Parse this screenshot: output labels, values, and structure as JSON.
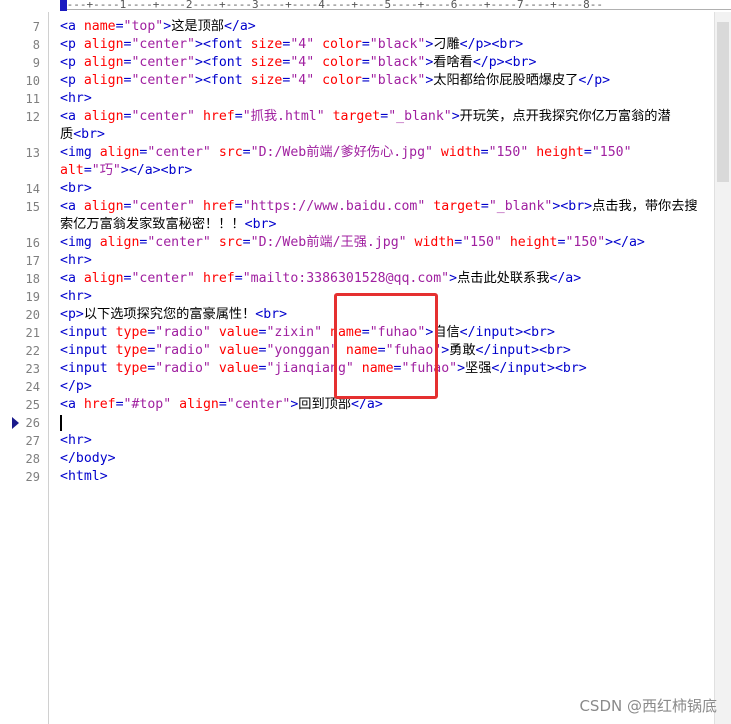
{
  "ruler": {
    "text": "----+----1----+----2----+----3----+----4----+----5----+----6----+----7----+----8--"
  },
  "current_line": "26",
  "lines": [
    {
      "n": "7",
      "spans": [
        [
          "t",
          "<a "
        ],
        [
          "a",
          "name"
        ],
        [
          "t",
          "="
        ],
        [
          "v",
          "\"top\""
        ],
        [
          "t",
          ">"
        ],
        [
          "x",
          "这是顶部"
        ],
        [
          "t",
          "</a>"
        ]
      ]
    },
    {
      "n": "8",
      "spans": [
        [
          "t",
          "<p "
        ],
        [
          "a",
          "align"
        ],
        [
          "t",
          "="
        ],
        [
          "v",
          "\"center\""
        ],
        [
          "t",
          ">"
        ],
        [
          "t",
          "<font "
        ],
        [
          "a",
          "size"
        ],
        [
          "t",
          "="
        ],
        [
          "v",
          "\"4\""
        ],
        [
          "t",
          " "
        ],
        [
          "a",
          "color"
        ],
        [
          "t",
          "="
        ],
        [
          "v",
          "\"black\""
        ],
        [
          "t",
          ">"
        ],
        [
          "x",
          "刁雕"
        ],
        [
          "t",
          "</p>"
        ],
        [
          "t",
          "<br>"
        ]
      ]
    },
    {
      "n": "9",
      "spans": [
        [
          "t",
          "<p "
        ],
        [
          "a",
          "align"
        ],
        [
          "t",
          "="
        ],
        [
          "v",
          "\"center\""
        ],
        [
          "t",
          ">"
        ],
        [
          "t",
          "<font "
        ],
        [
          "a",
          "size"
        ],
        [
          "t",
          "="
        ],
        [
          "v",
          "\"4\""
        ],
        [
          "t",
          " "
        ],
        [
          "a",
          "color"
        ],
        [
          "t",
          "="
        ],
        [
          "v",
          "\"black\""
        ],
        [
          "t",
          ">"
        ],
        [
          "x",
          "看啥看"
        ],
        [
          "t",
          "</p>"
        ],
        [
          "t",
          "<br>"
        ]
      ]
    },
    {
      "n": "10",
      "spans": [
        [
          "t",
          "<p "
        ],
        [
          "a",
          "align"
        ],
        [
          "t",
          "="
        ],
        [
          "v",
          "\"center\""
        ],
        [
          "t",
          ">"
        ],
        [
          "t",
          "<font "
        ],
        [
          "a",
          "size"
        ],
        [
          "t",
          "="
        ],
        [
          "v",
          "\"4\""
        ],
        [
          "t",
          " "
        ],
        [
          "a",
          "color"
        ],
        [
          "t",
          "="
        ],
        [
          "v",
          "\"black\""
        ],
        [
          "t",
          ">"
        ],
        [
          "x",
          "太阳都给你屁股晒爆皮了"
        ],
        [
          "t",
          "</p>"
        ]
      ]
    },
    {
      "n": "11",
      "spans": [
        [
          "t",
          "<hr>"
        ]
      ]
    },
    {
      "n": "12",
      "spans": [
        [
          "t",
          "<a "
        ],
        [
          "a",
          "align"
        ],
        [
          "t",
          "="
        ],
        [
          "v",
          "\"center\""
        ],
        [
          "t",
          " "
        ],
        [
          "a",
          "href"
        ],
        [
          "t",
          "="
        ],
        [
          "v",
          "\"抓我.html\""
        ],
        [
          "t",
          " "
        ],
        [
          "a",
          "target"
        ],
        [
          "t",
          "="
        ],
        [
          "v",
          "\"_blank\""
        ],
        [
          "t",
          ">"
        ],
        [
          "x",
          "开玩笑，点开我探究你亿万富翁的潜"
        ]
      ]
    },
    {
      "n": "",
      "spans": [
        [
          "x",
          "质"
        ],
        [
          "t",
          "<br>"
        ]
      ]
    },
    {
      "n": "13",
      "spans": [
        [
          "t",
          "<img "
        ],
        [
          "a",
          "align"
        ],
        [
          "t",
          "="
        ],
        [
          "v",
          "\"center\""
        ],
        [
          "t",
          " "
        ],
        [
          "a",
          "src"
        ],
        [
          "t",
          "="
        ],
        [
          "v",
          "\"D:/Web前端/爹好伤心.jpg\""
        ],
        [
          "t",
          " "
        ],
        [
          "a",
          "width"
        ],
        [
          "t",
          "="
        ],
        [
          "v",
          "\"150\""
        ],
        [
          "t",
          " "
        ],
        [
          "a",
          "height"
        ],
        [
          "t",
          "="
        ],
        [
          "v",
          "\"150\""
        ]
      ]
    },
    {
      "n": "",
      "spans": [
        [
          "a",
          "alt"
        ],
        [
          "t",
          "="
        ],
        [
          "v",
          "\"巧\""
        ],
        [
          "t",
          ">"
        ],
        [
          "t",
          "</a>"
        ],
        [
          "t",
          "<br>"
        ]
      ]
    },
    {
      "n": "14",
      "spans": [
        [
          "t",
          "<br>"
        ]
      ]
    },
    {
      "n": "15",
      "spans": [
        [
          "t",
          "<a "
        ],
        [
          "a",
          "align"
        ],
        [
          "t",
          "="
        ],
        [
          "v",
          "\"center\""
        ],
        [
          "t",
          " "
        ],
        [
          "a",
          "href"
        ],
        [
          "t",
          "="
        ],
        [
          "v",
          "\"https://www.baidu.com\""
        ],
        [
          "t",
          " "
        ],
        [
          "a",
          "target"
        ],
        [
          "t",
          "="
        ],
        [
          "v",
          "\"_blank\""
        ],
        [
          "t",
          ">"
        ],
        [
          "t",
          "<br>"
        ],
        [
          "x",
          "点击我，带你去搜"
        ]
      ]
    },
    {
      "n": "",
      "spans": [
        [
          "x",
          "索亿万富翁发家致富秘密！！！"
        ],
        [
          "t",
          "<br>"
        ]
      ]
    },
    {
      "n": "16",
      "spans": [
        [
          "t",
          "<img "
        ],
        [
          "a",
          "align"
        ],
        [
          "t",
          "="
        ],
        [
          "v",
          "\"center\""
        ],
        [
          "t",
          " "
        ],
        [
          "a",
          "src"
        ],
        [
          "t",
          "="
        ],
        [
          "v",
          "\"D:/Web前端/王强.jpg\""
        ],
        [
          "t",
          " "
        ],
        [
          "a",
          "width"
        ],
        [
          "t",
          "="
        ],
        [
          "v",
          "\"150\""
        ],
        [
          "t",
          " "
        ],
        [
          "a",
          "height"
        ],
        [
          "t",
          "="
        ],
        [
          "v",
          "\"150\""
        ],
        [
          "t",
          ">"
        ],
        [
          "t",
          "</a>"
        ]
      ]
    },
    {
      "n": "17",
      "spans": [
        [
          "t",
          "<hr>"
        ]
      ]
    },
    {
      "n": "18",
      "spans": [
        [
          "t",
          "<a "
        ],
        [
          "a",
          "align"
        ],
        [
          "t",
          "="
        ],
        [
          "v",
          "\"center\""
        ],
        [
          "t",
          " "
        ],
        [
          "a",
          "href"
        ],
        [
          "t",
          "="
        ],
        [
          "v",
          "\"mailto:3386301528@qq.com\""
        ],
        [
          "t",
          ">"
        ],
        [
          "x",
          "点击此处联系我"
        ],
        [
          "t",
          "</a>"
        ]
      ]
    },
    {
      "n": "19",
      "spans": [
        [
          "t",
          "<hr>"
        ]
      ]
    },
    {
      "n": "20",
      "spans": [
        [
          "t",
          "<p>"
        ],
        [
          "x",
          "以下选项探究您的富豪属性！"
        ],
        [
          "t",
          "<br>"
        ]
      ]
    },
    {
      "n": "21",
      "spans": [
        [
          "t",
          "<input "
        ],
        [
          "a",
          "type"
        ],
        [
          "t",
          "="
        ],
        [
          "v",
          "\"radio\""
        ],
        [
          "t",
          " "
        ],
        [
          "a",
          "value"
        ],
        [
          "t",
          "="
        ],
        [
          "v",
          "\"zixin\""
        ],
        [
          "t",
          " "
        ],
        [
          "a",
          "name"
        ],
        [
          "t",
          "="
        ],
        [
          "v",
          "\"fuhao\""
        ],
        [
          "t",
          ">"
        ],
        [
          "x",
          "自信"
        ],
        [
          "t",
          "</input>"
        ],
        [
          "t",
          "<br>"
        ]
      ]
    },
    {
      "n": "22",
      "spans": [
        [
          "t",
          "<input "
        ],
        [
          "a",
          "type"
        ],
        [
          "t",
          "="
        ],
        [
          "v",
          "\"radio\""
        ],
        [
          "t",
          " "
        ],
        [
          "a",
          "value"
        ],
        [
          "t",
          "="
        ],
        [
          "v",
          "\"yonggan\""
        ],
        [
          "t",
          " "
        ],
        [
          "a",
          "name"
        ],
        [
          "t",
          "="
        ],
        [
          "v",
          "\"fuhao\""
        ],
        [
          "t",
          ">"
        ],
        [
          "x",
          "勇敢"
        ],
        [
          "t",
          "</input>"
        ],
        [
          "t",
          "<br>"
        ]
      ]
    },
    {
      "n": "23",
      "spans": [
        [
          "t",
          "<input "
        ],
        [
          "a",
          "type"
        ],
        [
          "t",
          "="
        ],
        [
          "v",
          "\"radio\""
        ],
        [
          "t",
          " "
        ],
        [
          "a",
          "value"
        ],
        [
          "t",
          "="
        ],
        [
          "v",
          "\"jianqiang\""
        ],
        [
          "t",
          " "
        ],
        [
          "a",
          "name"
        ],
        [
          "t",
          "="
        ],
        [
          "v",
          "\"fuhao\""
        ],
        [
          "t",
          ">"
        ],
        [
          "x",
          "坚强"
        ],
        [
          "t",
          "</input>"
        ],
        [
          "t",
          "<br>"
        ]
      ]
    },
    {
      "n": "24",
      "spans": [
        [
          "t",
          "</p>"
        ]
      ]
    },
    {
      "n": "25",
      "spans": [
        [
          "t",
          "<a "
        ],
        [
          "a",
          "href"
        ],
        [
          "t",
          "="
        ],
        [
          "v",
          "\"#top\""
        ],
        [
          "t",
          " "
        ],
        [
          "a",
          "align"
        ],
        [
          "t",
          "="
        ],
        [
          "v",
          "\"center\""
        ],
        [
          "t",
          ">"
        ],
        [
          "x",
          "回到顶部"
        ],
        [
          "t",
          "</a>"
        ]
      ]
    },
    {
      "n": "26",
      "spans": []
    },
    {
      "n": "27",
      "spans": [
        [
          "t",
          "<hr>"
        ]
      ]
    },
    {
      "n": "28",
      "spans": [
        [
          "t",
          "</body>"
        ]
      ]
    },
    {
      "n": "29",
      "spans": [
        [
          "t",
          "<html>"
        ]
      ]
    }
  ],
  "watermark": "CSDN @西红柿锅底"
}
